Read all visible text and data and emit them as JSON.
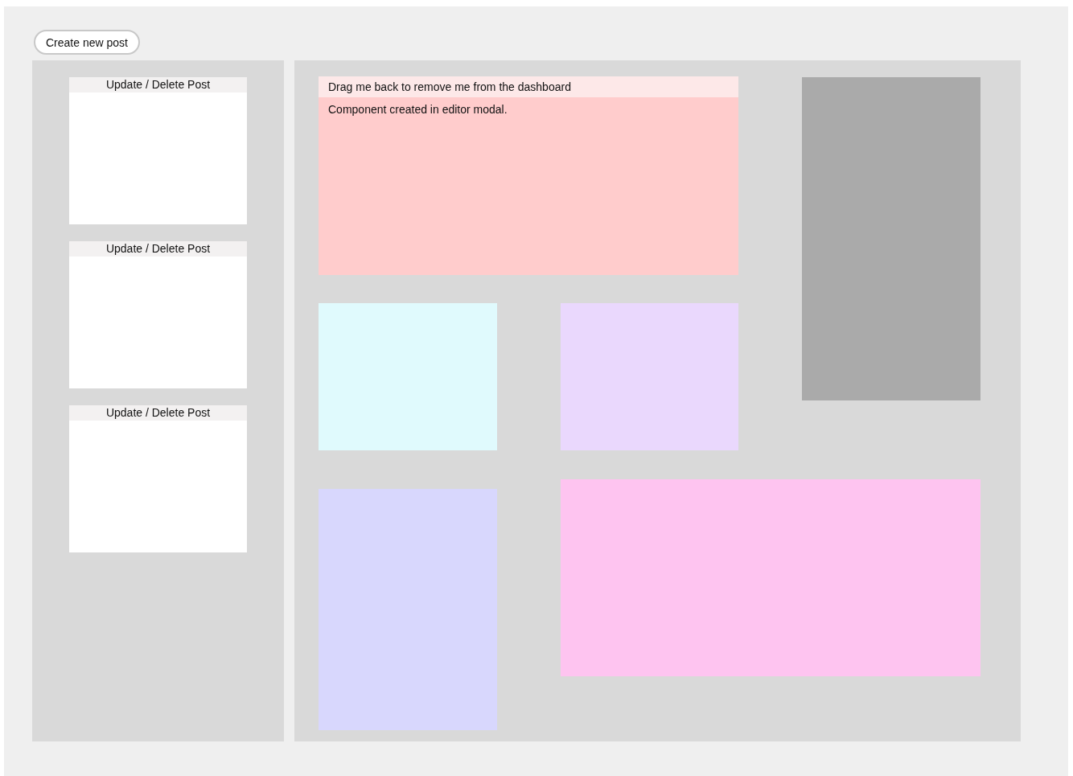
{
  "create_button": {
    "label": "Create new post"
  },
  "posts": [
    {
      "title": "Update / Delete Post"
    },
    {
      "title": "Update / Delete Post"
    },
    {
      "title": "Update / Delete Post"
    }
  ],
  "dashboard": {
    "tiles": [
      {
        "kind": "note",
        "color": "#ffcccc",
        "header": "Drag me back to remove me from the dashboard",
        "body": "Component created in editor modal."
      },
      {
        "kind": "block",
        "color": "#aaaaaa"
      },
      {
        "kind": "block",
        "color": "#e0fafd"
      },
      {
        "kind": "block",
        "color": "#ead8fd"
      },
      {
        "kind": "block",
        "color": "#d8d7fd"
      },
      {
        "kind": "block",
        "color": "#fec4f0"
      }
    ]
  }
}
